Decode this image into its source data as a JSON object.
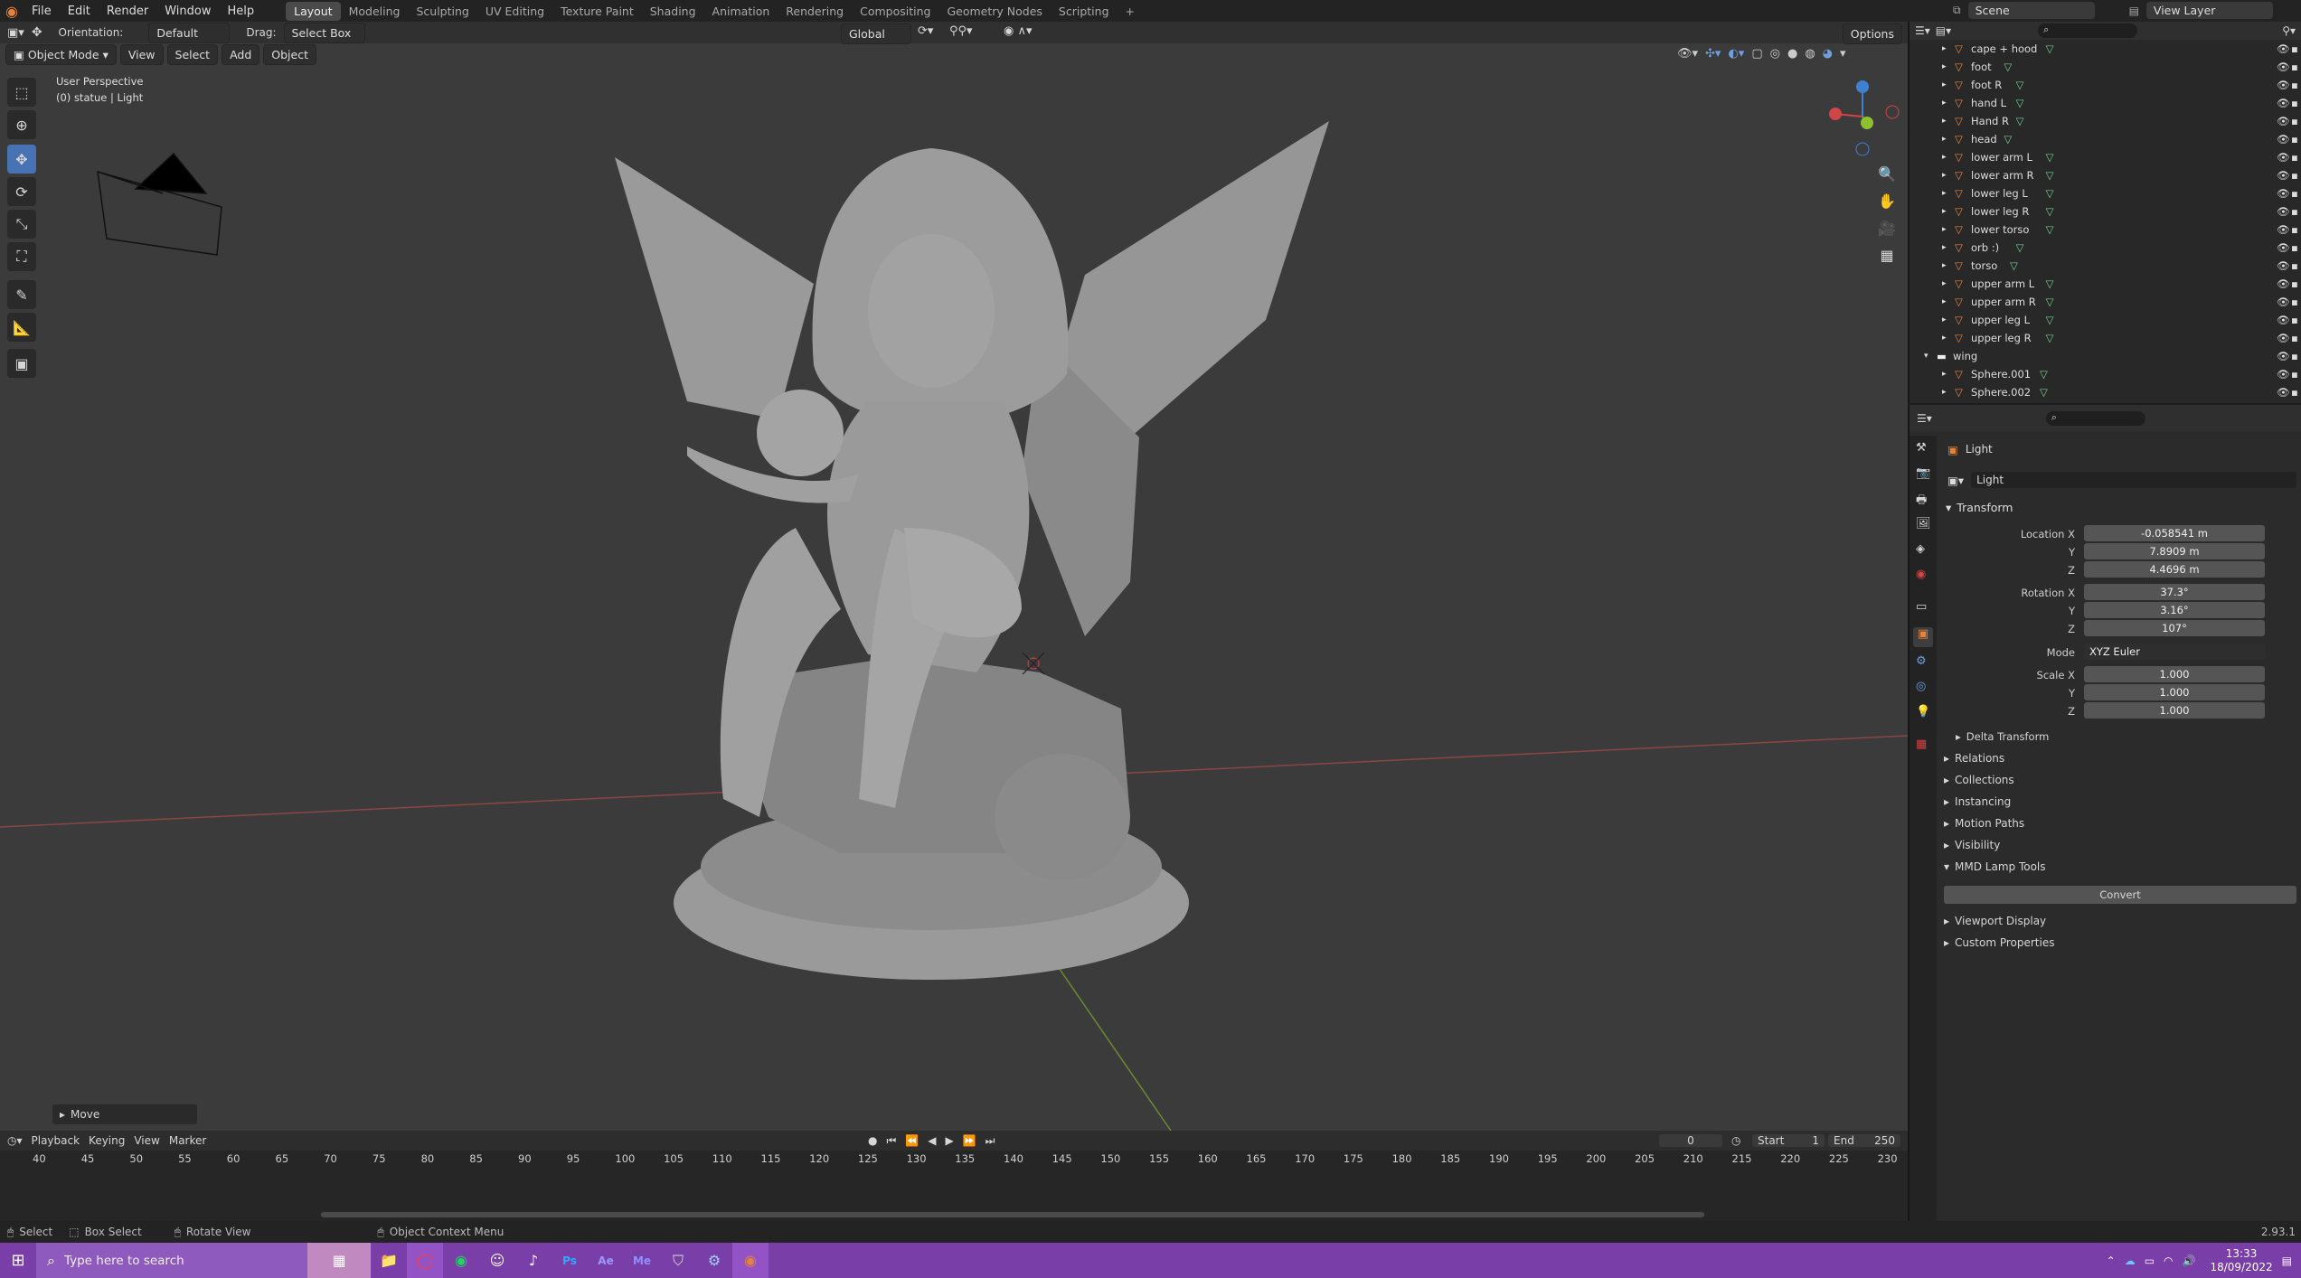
{
  "menu": {
    "items": [
      "File",
      "Edit",
      "Render",
      "Window",
      "Help"
    ]
  },
  "workspaces": [
    "Layout",
    "Modeling",
    "Sculpting",
    "UV Editing",
    "Texture Paint",
    "Shading",
    "Animation",
    "Rendering",
    "Compositing",
    "Geometry Nodes",
    "Scripting"
  ],
  "scene": {
    "name": "Scene",
    "view_layer": "View Layer"
  },
  "toolheader": {
    "orientation_label": "Orientation:",
    "orientation_value": "Default",
    "drag_label": "Drag:",
    "drag_value": "Select Box",
    "transform_space": "Global",
    "options": "Options"
  },
  "viewport_header": {
    "mode": "Object Mode",
    "view": "View",
    "select": "Select",
    "add": "Add",
    "object": "Object"
  },
  "viewport": {
    "perspective": "User Perspective",
    "context": "(0) statue | Light",
    "last_op": "Move"
  },
  "outliner": {
    "rows": [
      {
        "name": "cape + hood",
        "type": "mesh"
      },
      {
        "name": "foot",
        "type": "mesh"
      },
      {
        "name": "foot R",
        "type": "mesh"
      },
      {
        "name": "hand L",
        "type": "mesh"
      },
      {
        "name": "Hand R",
        "type": "mesh"
      },
      {
        "name": "head",
        "type": "mesh"
      },
      {
        "name": "lower arm L",
        "type": "mesh"
      },
      {
        "name": "lower arm R",
        "type": "mesh"
      },
      {
        "name": "lower leg L",
        "type": "mesh"
      },
      {
        "name": "lower leg R",
        "type": "mesh"
      },
      {
        "name": "lower torso",
        "type": "mesh"
      },
      {
        "name": "orb :)",
        "type": "mesh"
      },
      {
        "name": "torso",
        "type": "mesh"
      },
      {
        "name": "upper arm L",
        "type": "mesh"
      },
      {
        "name": "upper arm R",
        "type": "mesh"
      },
      {
        "name": "upper leg L",
        "type": "mesh"
      },
      {
        "name": "upper leg R",
        "type": "mesh"
      },
      {
        "name": "wing",
        "type": "collection"
      },
      {
        "name": "Sphere.001",
        "type": "mesh"
      },
      {
        "name": "Sphere.002",
        "type": "mesh"
      }
    ]
  },
  "properties": {
    "object_name": "Light",
    "data_name": "Light",
    "transform": {
      "title": "Transform",
      "location_x_label": "Location X",
      "location_x": "-0.058541 m",
      "location_y_label": "Y",
      "location_y": "7.8909 m",
      "location_z_label": "Z",
      "location_z": "4.4696 m",
      "rotation_x_label": "Rotation X",
      "rotation_x": "37.3°",
      "rotation_y_label": "Y",
      "rotation_y": "3.16°",
      "rotation_z_label": "Z",
      "rotation_z": "107°",
      "mode_label": "Mode",
      "mode": "XYZ Euler",
      "scale_x_label": "Scale X",
      "scale_x": "1.000",
      "scale_y_label": "Y",
      "scale_y": "1.000",
      "scale_z_label": "Z",
      "scale_z": "1.000",
      "delta": "Delta Transform"
    },
    "panels": [
      "Relations",
      "Collections",
      "Instancing",
      "Motion Paths",
      "Visibility"
    ],
    "mmd": {
      "title": "MMD Lamp Tools",
      "convert": "Convert"
    },
    "panels2": [
      "Viewport Display",
      "Custom Properties"
    ]
  },
  "timeline": {
    "playback": "Playback",
    "keying": "Keying",
    "view": "View",
    "marker": "Marker",
    "current": "0",
    "start_label": "Start",
    "start": "1",
    "end_label": "End",
    "end": "250",
    "ticks": [
      "40",
      "45",
      "50",
      "55",
      "60",
      "65",
      "70",
      "75",
      "80",
      "85",
      "90",
      "95",
      "100",
      "105",
      "110",
      "115",
      "120",
      "125",
      "130",
      "135",
      "140",
      "145",
      "150",
      "155",
      "160",
      "165",
      "170",
      "175",
      "180",
      "185",
      "190",
      "195",
      "200",
      "205",
      "210",
      "215",
      "220",
      "225",
      "230"
    ]
  },
  "status": {
    "select": "Select",
    "box_select": "Box Select",
    "rotate_view": "Rotate View",
    "context_menu": "Object Context Menu",
    "version": "2.93.1"
  },
  "taskbar": {
    "search_placeholder": "Type here to search",
    "time": "13:33",
    "date": "18/09/2022"
  },
  "colors": {
    "accent": "#4772b3",
    "mesh_icon": "#e6833a",
    "taskbar": "#7a3ea8"
  }
}
